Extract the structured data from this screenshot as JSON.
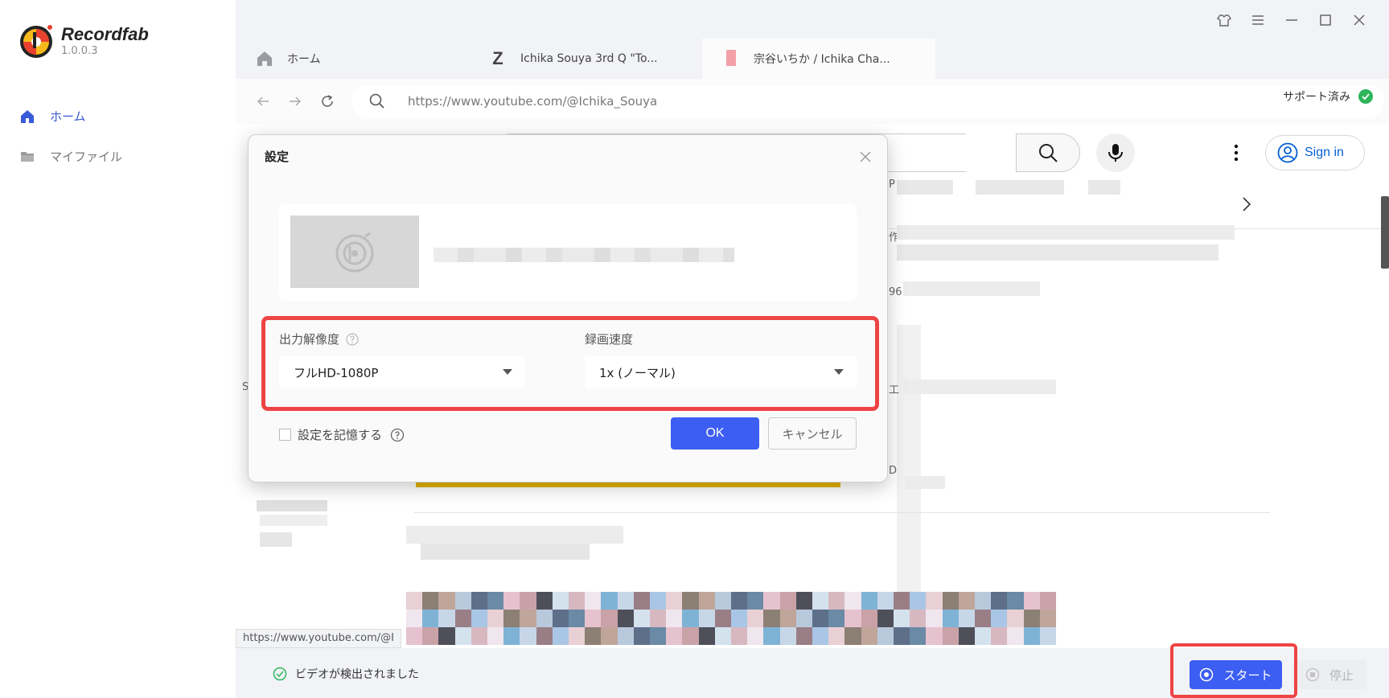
{
  "app": {
    "name": "Recordfab",
    "version": "1.0.0.3",
    "accent_color": "#3d5ef2",
    "highlight_color": "#ee4444"
  },
  "sidebar": {
    "items": [
      {
        "label": "ホーム",
        "icon": "home-icon",
        "active": true
      },
      {
        "label": "マイファイル",
        "icon": "folder-icon",
        "active": false
      }
    ]
  },
  "window_controls": [
    "skin-icon",
    "menu-icon",
    "minimize-icon",
    "maximize-icon",
    "close-icon"
  ],
  "tabs": [
    {
      "label": "ホーム",
      "icon": "home-icon"
    },
    {
      "label": "Ichika Souya 3rd Q \"To...",
      "icon": "Z"
    },
    {
      "label": "宗谷いちか / Ichika Cha...",
      "icon": "pink-favicon",
      "active": true
    }
  ],
  "address_bar": {
    "url": "https://www.youtube.com/@Ichika_Souya",
    "support_text": "サポート済み"
  },
  "page": {
    "sign_in_label": "Sign in",
    "peek_texts": [
      "P",
      "作",
      "96",
      "工",
      "D",
      "S"
    ]
  },
  "status_url": "https://www.youtube.com/@I",
  "dialog": {
    "title": "設定",
    "resolution_label": "出力解像度",
    "resolution_value": "フルHD-1080P",
    "speed_label": "録画速度",
    "speed_value": "1x (ノーマル)",
    "remember_label": "設定を記憶する",
    "remember_checked": false,
    "ok_label": "OK",
    "cancel_label": "キャンセル"
  },
  "bottom_bar": {
    "detected_text": "ビデオが検出されました",
    "start_label": "スタート",
    "stop_label": "停止"
  }
}
